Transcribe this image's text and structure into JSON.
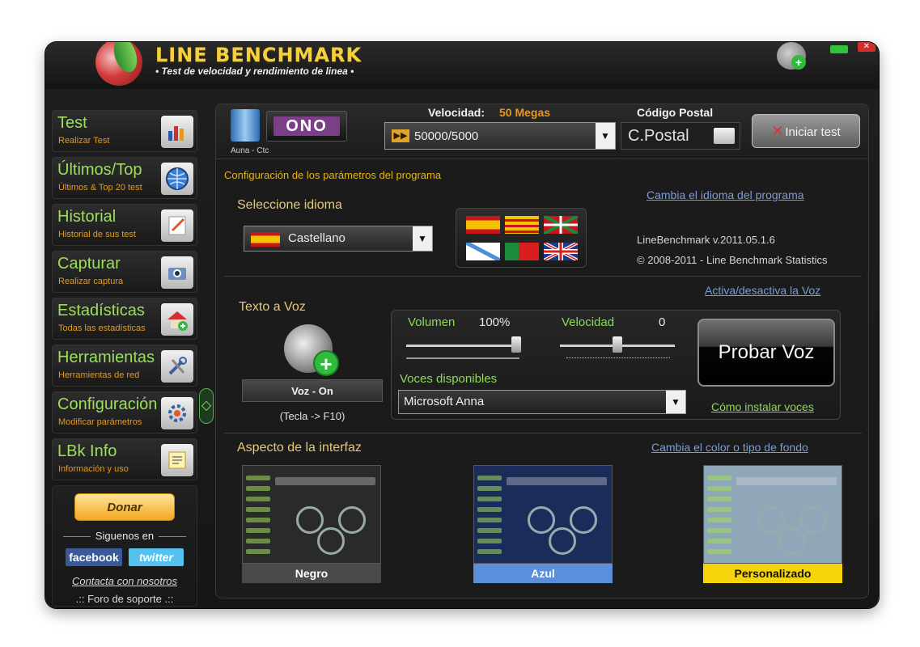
{
  "window": {
    "title": "LINE BENCHMARK",
    "subtitle": "• Test de velocidad y rendimiento de linea •"
  },
  "sidebar": {
    "items": [
      {
        "label": "Test",
        "sub": "Realizar Test",
        "icon": "chart-icon"
      },
      {
        "label": "Últimos/Top",
        "sub": "Últimos & Top 20 test",
        "icon": "globe-icon"
      },
      {
        "label": "Historial",
        "sub": "Historial de sus test",
        "icon": "notepad-icon"
      },
      {
        "label": "Capturar",
        "sub": "Realizar captura",
        "icon": "camera-icon"
      },
      {
        "label": "Estadísticas",
        "sub": "Todas las estadísticas",
        "icon": "house-icon"
      },
      {
        "label": "Herramientas",
        "sub": "Herramientas de red",
        "icon": "tools-icon"
      },
      {
        "label": "Configuración",
        "sub": "Modificar parámetros",
        "icon": "settings-icon"
      },
      {
        "label": "LBk Info",
        "sub": "Información y uso",
        "icon": "info-icon"
      }
    ],
    "donate": "Donar",
    "follow": "Siguenos en",
    "facebook": "facebook",
    "twitter": "twitter",
    "contact": "Contacta con nosotros",
    "forum": ".:: Foro de soporte .::"
  },
  "top": {
    "isp_name": "Auna - Ctc",
    "isp_logo": "ONO",
    "speed_label": "Velocidad:",
    "speed_value": "50 Megas",
    "speed_selected": "50000/5000",
    "postal_label": "Código Postal",
    "postal_placeholder": "C.Postal",
    "start_button": "Iniciar test"
  },
  "config": {
    "section_title": "Configuración de los parámetros del programa",
    "select_language": "Seleccione idioma",
    "language_selected": "Castellano",
    "change_language_link": "Cambia el idioma del programa",
    "version": "LineBenchmark v.2011.05.1.6",
    "copyright": "© 2008-2011 - Line Benchmark Statistics"
  },
  "voice": {
    "title": "Texto a Voz",
    "toggle_link": "Activa/desactiva la Voz",
    "voice_button": "Voz - On",
    "shortcut": "(Tecla -> F10)",
    "volume_label": "Volumen",
    "volume_value": "100%",
    "volume_level": 1.0,
    "speed_label": "Velocidad",
    "speed_value": "0",
    "available_label": "Voces disponibles",
    "voice_selected": "Microsoft Anna",
    "test_button": "Probar Voz",
    "install_link": "Cómo instalar voces"
  },
  "appearance": {
    "title": "Aspecto de la interfaz",
    "change_link": "Cambia el color o tipo de fondo",
    "themes": [
      {
        "label": "Negro",
        "color": "#2a2a2a",
        "label_bg": "#4a4a4a"
      },
      {
        "label": "Azul",
        "color": "#1c2c5a",
        "label_bg": "#5b8fdc"
      },
      {
        "label": "Personalizado",
        "color": "#8fa7b8",
        "label_bg": "#f5d40a"
      }
    ]
  }
}
